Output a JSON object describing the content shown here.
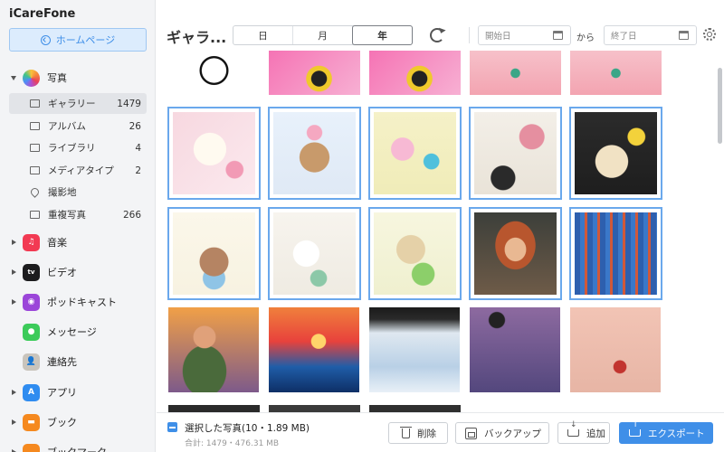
{
  "app": {
    "title": "iCareFone"
  },
  "sidebar": {
    "home_button": "ホームページ",
    "categories": [
      {
        "label": "写真",
        "icon": "photos-icon",
        "expanded": true
      },
      {
        "label": "音楽",
        "icon": "music-icon",
        "expanded": false
      },
      {
        "label": "ビデオ",
        "icon": "tv-icon",
        "expanded": false
      },
      {
        "label": "ポッドキャスト",
        "icon": "podcast-icon",
        "expanded": false
      },
      {
        "label": "メッセージ",
        "icon": "messages-icon",
        "expanded": false
      },
      {
        "label": "連絡先",
        "icon": "contacts-icon",
        "expanded": false
      },
      {
        "label": "アプリ",
        "icon": "appstore-icon",
        "expanded": false
      },
      {
        "label": "ブック",
        "icon": "books-icon",
        "expanded": false
      },
      {
        "label": "ブックマーク",
        "icon": "bookmark-icon",
        "expanded": false
      }
    ],
    "photo_items": [
      {
        "label": "ギャラリー",
        "count": "1479",
        "active": true
      },
      {
        "label": "アルバム",
        "count": "26"
      },
      {
        "label": "ライブラリ",
        "count": "4"
      },
      {
        "label": "メディアタイプ",
        "count": "2"
      },
      {
        "label": "撮影地",
        "count": ""
      },
      {
        "label": "重複写真",
        "count": "266"
      }
    ]
  },
  "header": {
    "title": "ギャラ...",
    "view_tabs": [
      "日",
      "月",
      "年"
    ],
    "active_tab": "年",
    "start_date_placeholder": "開始日",
    "kara": "から",
    "end_date_placeholder": "終了日"
  },
  "footer": {
    "selected_text": "選択した写真(10・1.89 MB)",
    "total_text": "合計: 1479・476.31 MB",
    "delete_label": "削除",
    "backup_label": "バックアップ",
    "add_label": "追加",
    "export_label": "エクスポート"
  },
  "colors": {
    "accent": "#3f8fe8",
    "selection_border": "#6aa8ec",
    "sidebar_bg": "#f3f4f6"
  }
}
